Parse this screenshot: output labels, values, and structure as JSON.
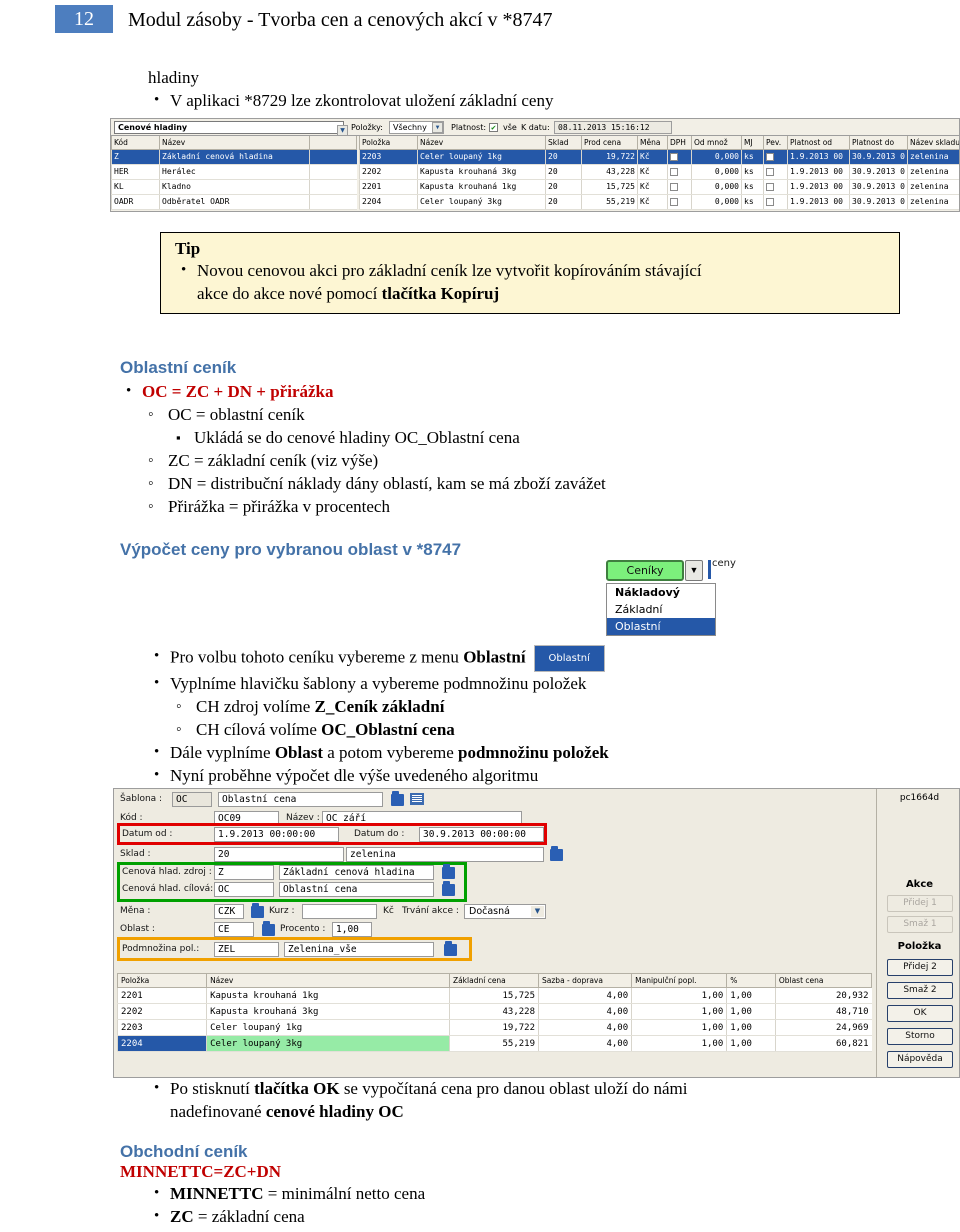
{
  "header": {
    "page_number": "12",
    "title": "Modul zásoby - Tvorba cen a cenových akcí v *8747",
    "accent_color": "#4d7ebf"
  },
  "intro": {
    "line1": "hladiny",
    "bullet1": "V aplikaci *8729 lze zkontrolovat uložení základní ceny"
  },
  "screenshot_hladiny": {
    "window_title": "Cenové hladiny",
    "toolbar": {
      "polozky_label": "Položky:",
      "polozky_value": "Všechny",
      "platnost_label": "Platnost:",
      "vse_label": "vše",
      "kdatu_label": "K datu:",
      "kdatu_value": "08.11.2013 15:16:12"
    },
    "left_grid": {
      "columns": [
        "Kód",
        "Název",
        ""
      ],
      "rows": [
        {
          "kod": "Z",
          "nazev": "Základní cenová hladina",
          "extra": "",
          "selected": true
        },
        {
          "kod": "HER",
          "nazev": "Herálec",
          "extra": "",
          "selected": false
        },
        {
          "kod": "KL",
          "nazev": "Kladno",
          "extra": "",
          "selected": false
        },
        {
          "kod": "OADR",
          "nazev": "Odběratel OADR",
          "extra": "",
          "selected": false
        }
      ]
    },
    "right_grid": {
      "columns": [
        "Položka",
        "Název",
        "Sklad",
        "Prod cena",
        "Měna",
        "DPH",
        "Od množ",
        "MJ",
        "Pev.",
        "Platnost od",
        "Platnost do",
        "Název skladu"
      ],
      "rows": [
        {
          "polozka": "2203",
          "nazev": "Celer loupaný 1kg",
          "sklad": "20",
          "cena": "19,722",
          "mena": "Kč",
          "dph": false,
          "odmnoz": "0,000",
          "mj": "ks",
          "pev": false,
          "od": "1.9.2013 00",
          "do": "30.9.2013 0",
          "nazev_skladu": "zelenina",
          "selected": true
        },
        {
          "polozka": "2202",
          "nazev": "Kapusta krouhaná 3kg",
          "sklad": "20",
          "cena": "43,228",
          "mena": "Kč",
          "dph": false,
          "odmnoz": "0,000",
          "mj": "ks",
          "pev": false,
          "od": "1.9.2013 00",
          "do": "30.9.2013 0",
          "nazev_skladu": "zelenina",
          "selected": false
        },
        {
          "polozka": "2201",
          "nazev": "Kapusta krouhaná 1kg",
          "sklad": "20",
          "cena": "15,725",
          "mena": "Kč",
          "dph": false,
          "odmnoz": "0,000",
          "mj": "ks",
          "pev": false,
          "od": "1.9.2013 00",
          "do": "30.9.2013 0",
          "nazev_skladu": "zelenina",
          "selected": false
        },
        {
          "polozka": "2204",
          "nazev": "Celer loupaný 3kg",
          "sklad": "20",
          "cena": "55,219",
          "mena": "Kč",
          "dph": false,
          "odmnoz": "0,000",
          "mj": "ks",
          "pev": false,
          "od": "1.9.2013 00",
          "do": "30.9.2013 0",
          "nazev_skladu": "zelenina",
          "selected": false
        }
      ]
    }
  },
  "tip": {
    "title": "Tip",
    "text_1": "Novou cenovou akci pro základní ceník lze vytvořit kopírováním stávající",
    "text_2": "akce do akce nové pomocí ",
    "text_2_bold": "tlačítka Kopíruj"
  },
  "oblastni_cenik": {
    "heading": "Oblastní ceník",
    "formula": "OC = ZC + DN + přirážka",
    "items": [
      {
        "text": "OC = oblastní ceník"
      },
      {
        "text": "ZC = základní ceník (viz výše)"
      },
      {
        "text": "DN = distribuční náklady dány oblastí, kam se má zboží zavážet"
      },
      {
        "text": "Přirážka = přirážka v procentech"
      }
    ],
    "subitem": "Ukládá se do cenové hladiny OC_Oblastní cena"
  },
  "vypocet_heading": "Výpočet ceny pro vybranou oblast v *8747",
  "ceniky_widget": {
    "button_label": "Ceníky",
    "arrow_glyph": "▼",
    "behind_text": "ceny",
    "menu_items": [
      {
        "label": "Nákladový",
        "bold": true,
        "selected": false
      },
      {
        "label": "Základní",
        "bold": false,
        "selected": false
      },
      {
        "label": "Oblastní",
        "bold": false,
        "selected": true
      }
    ]
  },
  "steps": {
    "b1_pre": "Pro volbu tohoto ceníku vybereme z menu ",
    "b1_bold": "Oblastní",
    "b1_badge": "Oblastní",
    "b2": "Vyplníme hlavičku šablony a vybereme podmnožinu položek",
    "b2_sub1_pre": "CH zdroj volíme ",
    "b2_sub1_bold": "Z_Ceník základní",
    "b2_sub2_pre": "CH cílová volíme ",
    "b2_sub2_bold": "OC_Oblastní cena",
    "b3_pre": "Dále vyplníme ",
    "b3_bold1": "Oblast",
    "b3_mid": " a potom vybereme ",
    "b3_bold2": "podmnožinu položek",
    "b4": "Nyní proběhne výpočet dle výše uvedeného algoritmu"
  },
  "screenshot_form": {
    "fields": {
      "sablona_label": "Šablona :",
      "sablona_code": "OC",
      "sablona_name": "Oblastní cena",
      "kod_label": "Kód :",
      "kod_value": "OC09",
      "nazev_label": "Název :",
      "nazev_value": "OC_září",
      "datum_od_label": "Datum od :",
      "datum_od_value": "1.9.2013 00:00:00",
      "datum_do_label": "Datum do :",
      "datum_do_value": "30.9.2013 00:00:00",
      "sklad_label": "Sklad :",
      "sklad_code": "20",
      "sklad_name": "zelenina",
      "ch_zdroj_label": "Cenová hlad. zdroj :",
      "ch_zdroj_code": "Z",
      "ch_zdroj_name": "Základní cenová hladina",
      "ch_cilova_label": "Cenová hlad. cílová:",
      "ch_cilova_code": "OC",
      "ch_cilova_name": "Oblastní cena",
      "mena_label": "Měna :",
      "mena_value": "CZK",
      "kurz_label": "Kurz :",
      "kurz_value": "",
      "kc_label": "Kč",
      "trvani_label": "Trvání akce :",
      "trvani_value": "Dočasná",
      "oblast_label": "Oblast :",
      "oblast_value": "CE",
      "procento_label": "Procento :",
      "procento_value": "1,00",
      "podmnozina_label": "Podmnožina pol.:",
      "podmnozina_code": "ZEL",
      "podmnozina_name": "Zelenina_vše"
    },
    "grid": {
      "columns": [
        "Položka",
        "Název",
        "Základní cena",
        "Sazba - doprava",
        "Manipulční popl.",
        "%",
        "Oblast cena"
      ],
      "rows": [
        {
          "polozka": "2201",
          "nazev": "Kapusta krouhaná 1kg",
          "zakladni": "15,725",
          "sazba": "4,00",
          "manip": "1,00",
          "pct": "1,00",
          "oblast": "20,932",
          "selected": false
        },
        {
          "polozka": "2202",
          "nazev": "Kapusta krouhaná 3kg",
          "zakladni": "43,228",
          "sazba": "4,00",
          "manip": "1,00",
          "pct": "1,00",
          "oblast": "48,710",
          "selected": false
        },
        {
          "polozka": "2203",
          "nazev": "Celer loupaný 1kg",
          "zakladni": "19,722",
          "sazba": "4,00",
          "manip": "1,00",
          "pct": "1,00",
          "oblast": "24,969",
          "selected": false
        },
        {
          "polozka": "2204",
          "nazev": "Celer loupaný 3kg",
          "zakladni": "55,219",
          "sazba": "4,00",
          "manip": "1,00",
          "pct": "1,00",
          "oblast": "60,821",
          "selected": true
        }
      ]
    },
    "right_panel": {
      "pc_name": "pc1664d",
      "akce_group": "Akce",
      "akce_buttons": [
        {
          "label": "Přidej 1",
          "disabled": true
        },
        {
          "label": "Smaž 1",
          "disabled": true
        }
      ],
      "polozka_group": "Položka",
      "polozka_buttons": [
        {
          "label": "Přidej 2",
          "disabled": false
        },
        {
          "label": "Smaž 2",
          "disabled": false
        },
        {
          "label": "OK",
          "disabled": false
        },
        {
          "label": "Storno",
          "disabled": false
        },
        {
          "label": "Nápověda",
          "disabled": false
        }
      ]
    },
    "highlight_colors": {
      "red": "#e00000",
      "green": "#00a000",
      "orange": "#f0a000"
    }
  },
  "closing": {
    "b1_pre": "Po stisknutí ",
    "b1_bold1": "tlačítka OK",
    "b1_mid": " se vypočítaná cena pro danou oblast uloží do námi",
    "b1_line2_pre": "nadefinované ",
    "b1_bold2": "cenové hladiny OC"
  },
  "obchodni_cenik": {
    "heading": "Obchodní ceník",
    "formula": "MINNETTC=ZC+DN",
    "items": [
      {
        "bold": "MINNETTC",
        "rest": " = minimální netto cena"
      },
      {
        "bold": "ZC",
        "rest": " = základní cena"
      }
    ]
  }
}
